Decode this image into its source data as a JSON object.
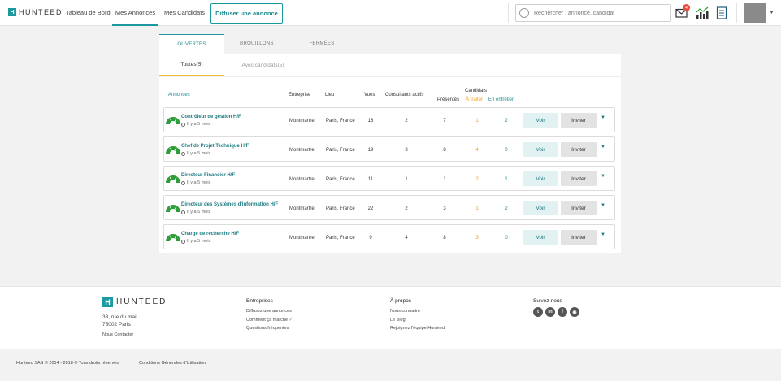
{
  "header": {
    "logo_mark": "H",
    "logo_text": "HUNTEED",
    "nav": [
      "Tableau de Bord",
      "Mes Annonces",
      "Mes Candidats"
    ],
    "post_button": "Diffuser une annonce",
    "search_placeholder": "Rechercher : annonce, candidat",
    "notification_count": "4",
    "icons": [
      "mail-icon",
      "chart-icon",
      "document-icon",
      "chevron-down-icon"
    ]
  },
  "status_tabs": [
    "OUVERTES",
    "BROUILLONS",
    "FERMÉES"
  ],
  "sub_tabs": [
    "Toutes(5)",
    "Avec candidats(5)"
  ],
  "columns": {
    "annonces": "Annonces",
    "entreprise": "Entreprise",
    "lieu": "Lieu",
    "vues": "Vues",
    "consultants": "Consultants actifs",
    "candidats": "Candidats",
    "presentes": "Présentés",
    "a_traiter": "À traiter",
    "en_entretien": "En entretien"
  },
  "rows": [
    {
      "title": "Contrôleur de gestion H/F",
      "age": "Il y a 5 mois",
      "company": "Montmartre",
      "place": "Paris, France",
      "views": "16",
      "consultants": "2",
      "presented": "7",
      "to_process": "1",
      "interview": "2"
    },
    {
      "title": "Chef de Projet Technique H/F",
      "age": "Il y a 5 mois",
      "company": "Montmartre",
      "place": "Paris, France",
      "views": "19",
      "consultants": "3",
      "presented": "8",
      "to_process": "4",
      "interview": "0"
    },
    {
      "title": "Directeur Financier H/F",
      "age": "Il y a 5 mois",
      "company": "Montmartre",
      "place": "Paris, France",
      "views": "11",
      "consultants": "1",
      "presented": "1",
      "to_process": "2",
      "interview": "1"
    },
    {
      "title": "Directeur des Systèmes d'information H/F",
      "age": "Il y a 5 mois",
      "company": "Montmartre",
      "place": "Paris, France",
      "views": "22",
      "consultants": "2",
      "presented": "3",
      "to_process": "1",
      "interview": "2"
    },
    {
      "title": "Chargé de recherche H/F",
      "age": "Il y a 5 mois",
      "company": "Montmartre",
      "place": "Paris, France",
      "views": "9",
      "consultants": "4",
      "presented": "8",
      "to_process": "3",
      "interview": "0"
    }
  ],
  "row_actions": {
    "voir": "Voir",
    "inviter": "Inviter"
  },
  "footer": {
    "logo_text": "HUNTEED",
    "address_line1": "33, rue du mail",
    "address_line2": "75002 Paris",
    "contact": "Nous Contacter",
    "entreprises_title": "Entreprises",
    "entreprises_links": [
      "Diffusez une annonces",
      "Comment ça marche ?",
      "Questions fréquentes"
    ],
    "apropos_title": "À propos",
    "apropos_links": [
      "Nous connaitre",
      "Le Blog",
      "Rejoignez l'équipe Hunteed"
    ],
    "social_title": "Suivez-nous",
    "social": [
      {
        "icon": "twitter-icon",
        "glyph": "t"
      },
      {
        "icon": "linkedin-icon",
        "glyph": "in"
      },
      {
        "icon": "facebook-icon",
        "glyph": "f"
      },
      {
        "icon": "rss-icon",
        "glyph": "◉"
      }
    ],
    "copyright": "Hunteed SAS © 2014 - 2018 ® Tous droits réservés",
    "cgu": "Conditions Générales d'Utilisation"
  },
  "colors": {
    "accent": "#1a9aa0",
    "orange": "#f39c12",
    "gauge_green": "#2e9e3a"
  }
}
